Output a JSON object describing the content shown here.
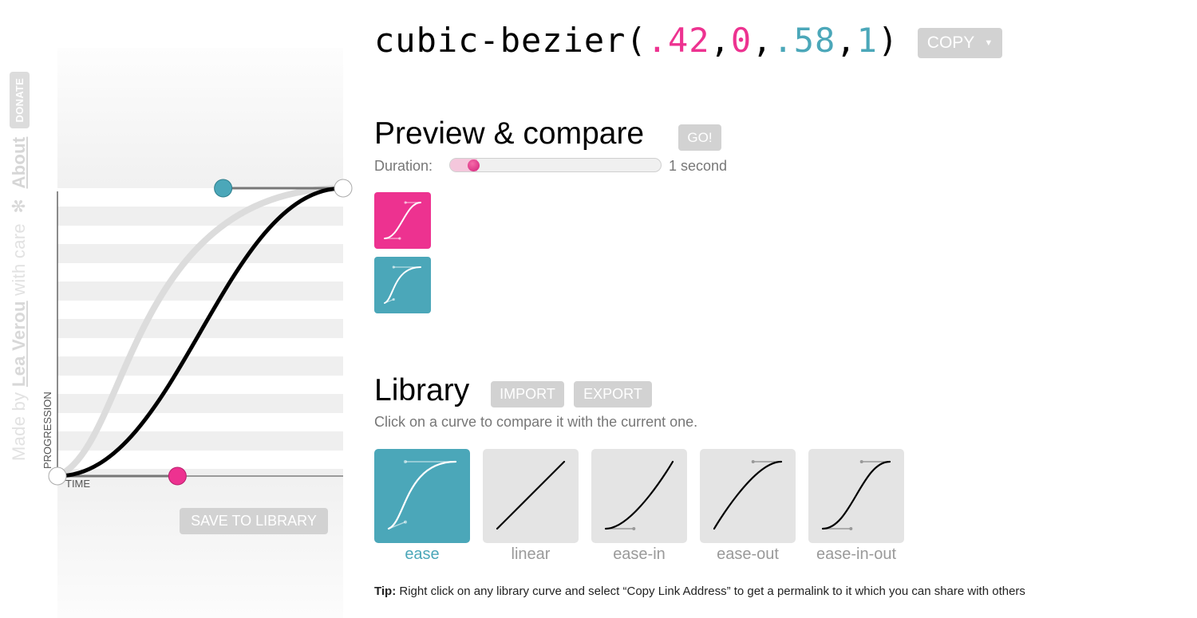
{
  "sidebar": {
    "made_by_prefix": "Made by ",
    "author": "Lea Verou",
    "made_by_suffix": " with care",
    "separator_icon": "✻",
    "about_label": "About",
    "donate_label": "DONATE"
  },
  "editor": {
    "curve": {
      "p1x": 0.42,
      "p1y": 0,
      "p2x": 0.58,
      "p2y": 1
    },
    "compare_curve": {
      "p1x": 0.25,
      "p1y": 0.1,
      "p2x": 0.25,
      "p2y": 1
    },
    "axis_progression": "PROGRESSION",
    "axis_time": "TIME",
    "save_label": "SAVE TO LIBRARY",
    "colors": {
      "p1": "#ed3290",
      "p2": "#4ba7b9"
    }
  },
  "header": {
    "func_name": "cubic-bezier(",
    "v1": ".42",
    "comma1": ",",
    "v2": "0",
    "comma2": ",",
    "v3": ".58",
    "comma3": ",",
    "v4": "1",
    "close": ")",
    "copy_label": "COPY",
    "copy_caret": "▼"
  },
  "preview": {
    "title": "Preview & compare",
    "go_label": "GO!",
    "duration_label": "Duration:",
    "duration_value": "1 second"
  },
  "library": {
    "title": "Library",
    "import_label": "IMPORT",
    "export_label": "EXPORT",
    "hint": "Click on a curve to compare it with the current one.",
    "items": [
      {
        "name": "ease",
        "selected": true,
        "p": [
          0.25,
          0.1,
          0.25,
          1
        ]
      },
      {
        "name": "linear",
        "selected": false,
        "p": [
          0,
          0,
          1,
          1
        ]
      },
      {
        "name": "ease-in",
        "selected": false,
        "p": [
          0.42,
          0,
          1,
          1
        ]
      },
      {
        "name": "ease-out",
        "selected": false,
        "p": [
          0,
          0,
          0.58,
          1
        ]
      },
      {
        "name": "ease-in-out",
        "selected": false,
        "p": [
          0.42,
          0,
          0.58,
          1
        ]
      }
    ]
  },
  "tip": {
    "label": "Tip:",
    "text": " Right click on any library curve and select “Copy Link Address” to get a permalink to it which you can share with others"
  }
}
